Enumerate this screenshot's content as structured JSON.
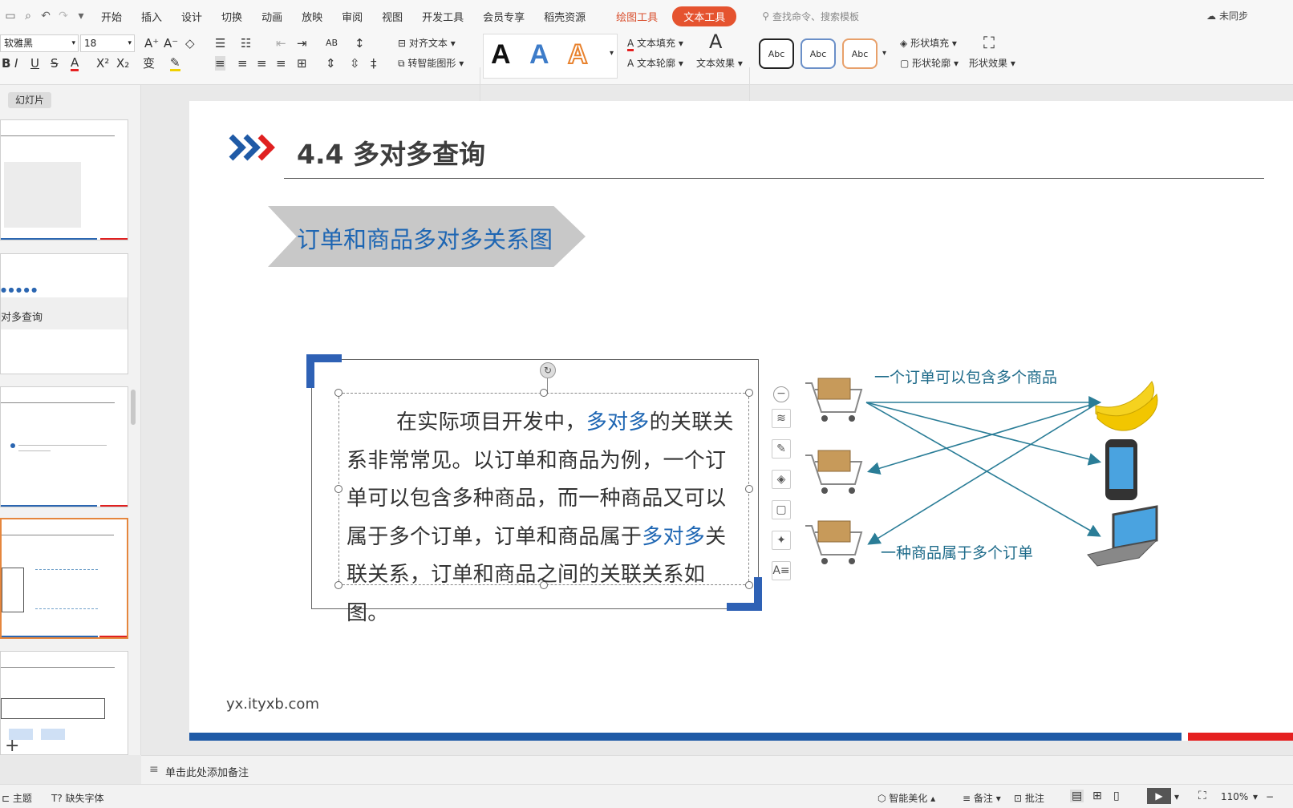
{
  "menubar": {
    "tabs": [
      "开始",
      "插入",
      "设计",
      "切换",
      "动画",
      "放映",
      "审阅",
      "视图",
      "开发工具",
      "会员专享",
      "稻壳资源"
    ],
    "context_tabs": [
      "绘图工具"
    ],
    "active_tab": "文本工具",
    "search_placeholder": "查找命令、搜索模板",
    "sync_label": "未同步"
  },
  "ribbon": {
    "font_name": "软雅黑",
    "font_size": "18",
    "align_text": "对齐文本",
    "smart_shape": "转智能图形",
    "text_fill": "文本填充",
    "text_outline": "文本轮廓",
    "text_effect": "文本效果",
    "style_sample": "Abc",
    "shape_fill": "形状填充",
    "shape_outline": "形状轮廓",
    "shape_effect": "形状效果"
  },
  "left_panel": {
    "button": "幻灯片",
    "thumb2_title": "对多查询"
  },
  "slide": {
    "section_title": "4.4  多对多查询",
    "banner": "订单和商品多对多关系图",
    "body": {
      "p1": "在实际项目开发中，",
      "hl1": "多对多",
      "p2": "的关联关系非常常见。以订单和商品为例，一个订单可以包含多种商品，而一种商品又可以属于多个订单，订单和商品属于",
      "hl2": "多对多",
      "p3": "关联关系，订单和商品之间的关联关系如图。"
    },
    "diagram": {
      "label_top": "一个订单可以包含多个商品",
      "label_bottom": "一种商品属于多个订单"
    },
    "footer_url": "yx.ityxb.com"
  },
  "notes": {
    "placeholder": "单击此处添加备注"
  },
  "status": {
    "theme": "主题",
    "missing_font": "缺失字体",
    "smart_beautify": "智能美化",
    "notes": "备注",
    "comments": "批注",
    "zoom": "110%"
  },
  "colors": {
    "accent_blue": "#1e66b3",
    "accent_red": "#e52020",
    "context_orange": "#e5532f"
  }
}
